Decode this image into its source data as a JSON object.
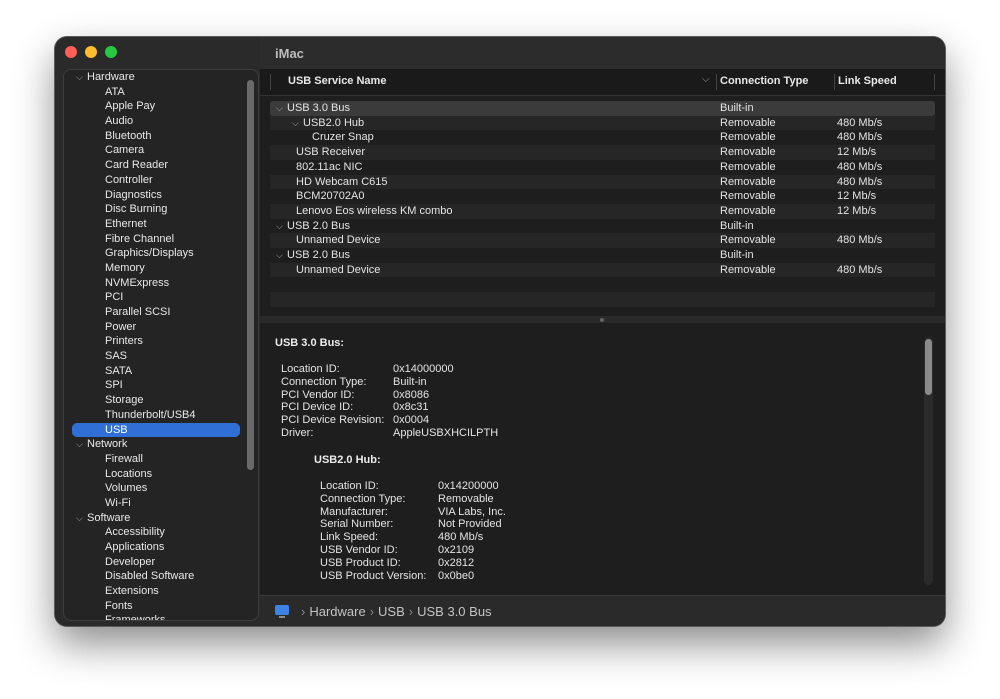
{
  "window": {
    "title": "iMac"
  },
  "sidebar": {
    "items": [
      {
        "type": "group",
        "label": "Hardware"
      },
      {
        "type": "child",
        "label": "ATA"
      },
      {
        "type": "child",
        "label": "Apple Pay"
      },
      {
        "type": "child",
        "label": "Audio"
      },
      {
        "type": "child",
        "label": "Bluetooth"
      },
      {
        "type": "child",
        "label": "Camera"
      },
      {
        "type": "child",
        "label": "Card Reader"
      },
      {
        "type": "child",
        "label": "Controller"
      },
      {
        "type": "child",
        "label": "Diagnostics"
      },
      {
        "type": "child",
        "label": "Disc Burning"
      },
      {
        "type": "child",
        "label": "Ethernet"
      },
      {
        "type": "child",
        "label": "Fibre Channel"
      },
      {
        "type": "child",
        "label": "Graphics/Displays"
      },
      {
        "type": "child",
        "label": "Memory"
      },
      {
        "type": "child",
        "label": "NVMExpress"
      },
      {
        "type": "child",
        "label": "PCI"
      },
      {
        "type": "child",
        "label": "Parallel SCSI"
      },
      {
        "type": "child",
        "label": "Power"
      },
      {
        "type": "child",
        "label": "Printers"
      },
      {
        "type": "child",
        "label": "SAS"
      },
      {
        "type": "child",
        "label": "SATA"
      },
      {
        "type": "child",
        "label": "SPI"
      },
      {
        "type": "child",
        "label": "Storage"
      },
      {
        "type": "child",
        "label": "Thunderbolt/USB4"
      },
      {
        "type": "child",
        "label": "USB",
        "selected": true
      },
      {
        "type": "group",
        "label": "Network"
      },
      {
        "type": "child",
        "label": "Firewall"
      },
      {
        "type": "child",
        "label": "Locations"
      },
      {
        "type": "child",
        "label": "Volumes"
      },
      {
        "type": "child",
        "label": "Wi-Fi"
      },
      {
        "type": "group",
        "label": "Software"
      },
      {
        "type": "child",
        "label": "Accessibility"
      },
      {
        "type": "child",
        "label": "Applications"
      },
      {
        "type": "child",
        "label": "Developer"
      },
      {
        "type": "child",
        "label": "Disabled Software"
      },
      {
        "type": "child",
        "label": "Extensions"
      },
      {
        "type": "child",
        "label": "Fonts"
      },
      {
        "type": "child",
        "label": "Frameworks"
      }
    ]
  },
  "table": {
    "columns": {
      "name": "USB Service Name",
      "connection": "Connection Type",
      "speed": "Link Speed"
    },
    "rows": [
      {
        "indent": 0,
        "chevron": true,
        "name": "USB 3.0 Bus",
        "connection": "Built-in",
        "speed": ""
      },
      {
        "indent": 1,
        "chevron": true,
        "name": "USB2.0 Hub",
        "connection": "Removable",
        "speed": "480 Mb/s"
      },
      {
        "indent": 2,
        "chevron": false,
        "name": "Cruzer Snap",
        "connection": "Removable",
        "speed": "480 Mb/s"
      },
      {
        "indent": 1,
        "chevron": false,
        "name": "USB Receiver",
        "connection": "Removable",
        "speed": "12 Mb/s"
      },
      {
        "indent": 1,
        "chevron": false,
        "name": "802.11ac NIC",
        "connection": "Removable",
        "speed": "480 Mb/s"
      },
      {
        "indent": 1,
        "chevron": false,
        "name": "HD Webcam C615",
        "connection": "Removable",
        "speed": "480 Mb/s"
      },
      {
        "indent": 1,
        "chevron": false,
        "name": "BCM20702A0",
        "connection": "Removable",
        "speed": "12 Mb/s"
      },
      {
        "indent": 1,
        "chevron": false,
        "name": "Lenovo Eos wireless KM combo",
        "connection": "Removable",
        "speed": "12 Mb/s"
      },
      {
        "indent": 0,
        "chevron": true,
        "name": "USB 2.0 Bus",
        "connection": "Built-in",
        "speed": ""
      },
      {
        "indent": 1,
        "chevron": false,
        "name": "Unnamed Device",
        "connection": "Removable",
        "speed": "480 Mb/s"
      },
      {
        "indent": 0,
        "chevron": true,
        "name": "USB 2.0 Bus",
        "connection": "Built-in",
        "speed": ""
      },
      {
        "indent": 1,
        "chevron": false,
        "name": "Unnamed Device",
        "connection": "Removable",
        "speed": "480 Mb/s"
      }
    ]
  },
  "detail": {
    "bus_title": "USB 3.0 Bus:",
    "bus_props": [
      {
        "k": "Location ID:",
        "v": "0x14000000"
      },
      {
        "k": "Connection Type:",
        "v": "Built-in"
      },
      {
        "k": "PCI Vendor ID:",
        "v": "0x8086"
      },
      {
        "k": "PCI Device ID:",
        "v": "0x8c31"
      },
      {
        "k": "PCI Device Revision:",
        "v": "0x0004"
      },
      {
        "k": "Driver:",
        "v": "AppleUSBXHCILPTH"
      }
    ],
    "hub_title": "USB2.0 Hub:",
    "hub_props": [
      {
        "k": "Location ID:",
        "v": "0x14200000"
      },
      {
        "k": "Connection Type:",
        "v": "Removable"
      },
      {
        "k": "Manufacturer:",
        "v": "VIA Labs, Inc."
      },
      {
        "k": "Serial Number:",
        "v": "Not Provided"
      },
      {
        "k": "Link Speed:",
        "v": "480 Mb/s"
      },
      {
        "k": "USB Vendor ID:",
        "v": "0x2109"
      },
      {
        "k": "USB Product ID:",
        "v": "0x2812"
      },
      {
        "k": "USB Product Version:",
        "v": "0x0be0"
      }
    ]
  },
  "pathbar": {
    "crumbs": [
      "Hardware",
      "USB",
      "USB 3.0 Bus"
    ]
  }
}
